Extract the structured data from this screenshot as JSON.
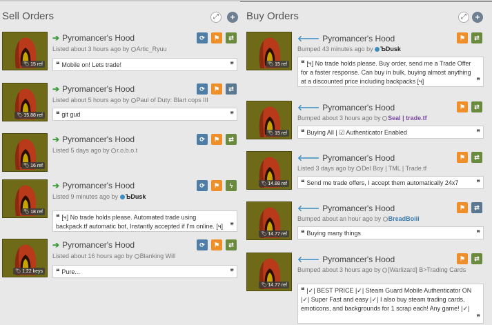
{
  "sell": {
    "title": "Sell Orders",
    "expand_icon": "expand-icon",
    "add_icon": "add-icon",
    "listings": [
      {
        "name": "Pyromancer's Hood",
        "meta_prefix": "Listed about 3 hours ago by ",
        "user": "Artic_Ryuu",
        "comment": "Mobile on! Lets trade!",
        "price": "15 ref"
      },
      {
        "name": "Pyromancer's Hood",
        "meta_prefix": "Listed about 5 hours ago by ",
        "user": "Paul of Duty: Blart cops III",
        "comment": "git gud",
        "price": "15.88 ref"
      },
      {
        "name": "Pyromancer's Hood",
        "meta_prefix": "Listed 5 days ago by ",
        "user": "r.o.b.o.t",
        "comment": "",
        "price": "16 ref"
      },
      {
        "name": "Pyromancer's Hood",
        "meta_prefix": "Listed 9 minutes ago by ",
        "user": "ЪDusk",
        "comment": "[ч] No trade holds please. Automated trade using backpack.tf automatic bot, Instantly accepted if I'm online. [ч]",
        "price": "18 ref"
      },
      {
        "name": "Pyromancer's Hood",
        "meta_prefix": "Listed about 16 hours ago by ",
        "user": "Blanking Will",
        "comment": "Pure...",
        "price": "1.22 keys"
      }
    ]
  },
  "buy": {
    "title": "Buy Orders",
    "listings": [
      {
        "name": "Pyromancer's Hood",
        "meta_prefix": "Bumped 43 minutes ago by ",
        "user": "ЪDusk",
        "comment": "[ч] No trade holds please. Buy order, send me a Trade Offer for a faster response. Can buy in bulk, buying almost anything at a discounted price including backpacks [ч]",
        "price": "15 ref"
      },
      {
        "name": "Pyromancer's Hood",
        "meta_prefix": "Bumped about 3 hours ago by ",
        "user": "Seal | trade.tf",
        "comment": "Buying All | ☑ Authenticator Enabled",
        "price": "15 ref"
      },
      {
        "name": "Pyromancer's Hood",
        "meta_prefix": "Listed 3 days ago by ",
        "user": "Del Boy | TML | Trade.tf",
        "comment": "Send me trade offers, I accept them automatically 24x7",
        "price": "14.88 ref"
      },
      {
        "name": "Pyromancer's Hood",
        "meta_prefix": "Bumped about an hour ago by ",
        "user": "BreadBoiii",
        "comment": "Buying many things",
        "price": "14.77 ref"
      },
      {
        "name": "Pyromancer's Hood",
        "meta_prefix": "Bumped about 3 hours ago by ",
        "user": "[Warlizard] B>Trading Cards",
        "comment": "|✓| BEST PRICE |✓| Steam Guard Mobile Authenticator ON |✓| Super Fast and easy |✓| I also buy steam trading cards, emoticons, and backgrounds for 1 scrap each! Any game! |✓|",
        "price": "14.77 ref"
      }
    ]
  },
  "colors": {
    "accent_green": "#3a9a3a",
    "accent_blue": "#3b8ec0",
    "flag_orange": "#ef8f2a",
    "refresh_blue": "#4e7da6",
    "trade_green": "#6a8a3e"
  },
  "icons": {
    "quote_open": "❝",
    "quote_close": "❞",
    "arrow_right": "➔",
    "arrow_left": "🡐",
    "refresh": "⟳",
    "flag": "⚑",
    "trade": "⇄",
    "bolt": "ϟ"
  }
}
